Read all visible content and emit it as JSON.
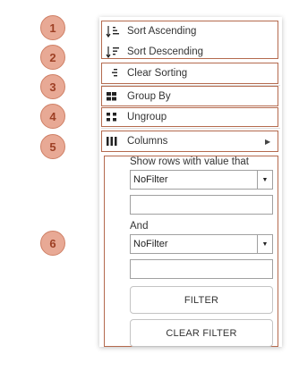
{
  "callouts": [
    "1",
    "2",
    "3",
    "4",
    "5",
    "6"
  ],
  "menu": {
    "sort_ascending": {
      "label": "Sort Ascending",
      "icon": "sort-ascending-icon"
    },
    "sort_descending": {
      "label": "Sort Descending",
      "icon": "sort-descending-icon"
    },
    "clear_sorting": {
      "label": "Clear Sorting",
      "icon": "clear-sorting-icon"
    },
    "group_by": {
      "label": "Group By",
      "icon": "group-by-icon"
    },
    "ungroup": {
      "label": "Ungroup",
      "icon": "ungroup-icon"
    },
    "columns": {
      "label": "Columns",
      "icon": "columns-icon",
      "submenu_arrow": "▶"
    }
  },
  "filter": {
    "heading": "Show rows with value that",
    "operator1": "NoFilter",
    "value1": "",
    "conjunction": "And",
    "operator2": "NoFilter",
    "value2": "",
    "filter_button": "FILTER",
    "clear_filter_button": "CLEAR FILTER"
  },
  "colors": {
    "callout_fill": "#e8a995",
    "callout_text": "#9d3f24",
    "highlight_border": "#b46a4e"
  }
}
